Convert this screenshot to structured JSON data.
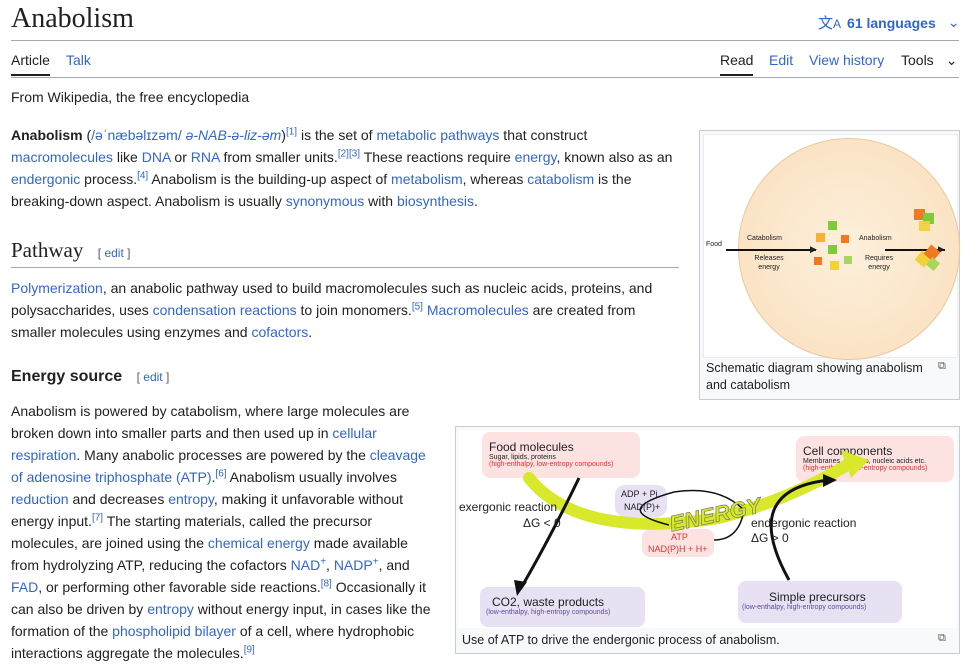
{
  "page": {
    "title": "Anabolism",
    "languages": "61 languages",
    "tabs_left": [
      "Article",
      "Talk"
    ],
    "tabs_right": [
      "Read",
      "Edit",
      "View history",
      "Tools"
    ],
    "from": "From Wikipedia, the free encyclopedia"
  },
  "intro": {
    "bold": "Anabolism",
    "ipa": "/əˈnæbəlɪzəm/",
    "respell": "ə-NAB-ə-liz-əm",
    "refs": [
      "[1]",
      "[2]",
      "[3]",
      "[4]"
    ],
    "t1": " is the set of ",
    "l_metabolic": "metabolic pathways",
    "t2": " that construct",
    "l_macro": "macromolecules",
    "t3": " like ",
    "l_dna": "DNA",
    "t4": " or ",
    "l_rna": "RNA",
    "t5": " from smaller units.",
    "t6": " These reactions require ",
    "l_energy": "energy",
    "t7": ", known also as an",
    "l_endergonic": "endergonic",
    "t8": " process.",
    "t9": " Anabolism is the building-up aspect of ",
    "l_metabolism": "metabolism",
    "t10": ", whereas ",
    "l_catabolism": "catabolism",
    "t11": " is the",
    "t12": "breaking-down aspect. Anabolism is usually ",
    "l_synonymous": "synonymous",
    "t13": " with ",
    "l_biosynthesis": "biosynthesis",
    "t14": "."
  },
  "pathway": {
    "heading": "Pathway",
    "edit": "edit",
    "l_poly": "Polymerization",
    "t1": ", an anabolic pathway used to build macromolecules such as nucleic acids, proteins, and",
    "t2": "polysaccharides, uses ",
    "l_cond": "condensation reactions",
    "t3": " to join monomers.",
    "ref": "[5]",
    "l_macro": "Macromolecules",
    "t4": " are created from",
    "t5": "smaller molecules using enzymes and ",
    "l_cof": "cofactors",
    "t6": "."
  },
  "energy": {
    "heading": "Energy source",
    "edit": "edit",
    "lines": {
      "a": "Anabolism is powered by catabolism, where large molecules are",
      "b1": "broken down into smaller parts and then used up in ",
      "b2": "cellular",
      "c1": "respiration",
      "c2": ". Many anabolic processes are powered by the ",
      "c3": "cleavage",
      "d1": "of adenosine triphosphate (ATP)",
      "d2": ".",
      "d3": "[6]",
      "d4": " Anabolism usually involves",
      "e1": "reduction",
      "e2": " and decreases ",
      "e3": "entropy",
      "e4": ", making it unfavorable without",
      "f1": "energy input.",
      "f2": "[7]",
      "f3": " The starting materials, called the precursor",
      "g1": "molecules, are joined using the ",
      "g2": "chemical energy",
      "g3": " made available",
      "h1": "from hydrolyzing ATP, reducing the cofactors ",
      "h2": "NAD",
      "h3": "+",
      "h4": ", ",
      "h5": "NADP",
      "h6": "+",
      "h7": ", and",
      "i1": "FAD",
      "i2": ", or performing other favorable side reactions.",
      "i3": "[8]",
      "i4": " Occasionally it",
      "j1": "can also be driven by ",
      "j2": "entropy",
      "j3": " without energy input, in cases like the",
      "k1": "formation of the ",
      "k2": "phospholipid bilayer",
      "k3": " of a cell, where hydrophobic",
      "l1": "interactions aggregate the molecules.",
      "l2": "[9]"
    }
  },
  "figure1": {
    "food": "Food",
    "catabolism": "Catabolism",
    "releases": "Releases energy",
    "anabolism": "Anabolism",
    "requires": "Requires energy",
    "caption": "Schematic diagram showing anabolism and catabolism"
  },
  "figure2": {
    "food_title": "Food molecules",
    "food_sub": "Sugar, lipids, proteins",
    "food_sub2": "(high-enthalpy, low-entropy compounds)",
    "cell_title": "Cell components",
    "cell_sub": "Membranes, proteins, nucleic acids etc.",
    "cell_sub2": "(high-enthalpy, low-entropy compounds)",
    "exergonic": "exergonic reaction",
    "dg_exer": "ΔG < 0",
    "endergonic": "endergonic reaction",
    "dg_ender": "ΔG > 0",
    "adp": "ADP + Pi",
    "nadp": "NAD(P)+",
    "atp": "ATP",
    "nadph": "NAD(P)H + H+",
    "energy": "ENERGY",
    "co2": "CO2, waste products",
    "co2_sub": "(low-enthalpy, high-entropy compounds)",
    "simple": "Simple precursors",
    "simple_sub": "(low-enthalpy, high-entropy compounds)",
    "caption": "Use of ATP to drive the endergonic process of anabolism."
  },
  "colors": {
    "link": "#3366cc",
    "text": "#202122",
    "border": "#a2a9b1"
  },
  "icons": [
    "translate-icon",
    "chevron-down-icon",
    "enlarge-icon"
  ]
}
